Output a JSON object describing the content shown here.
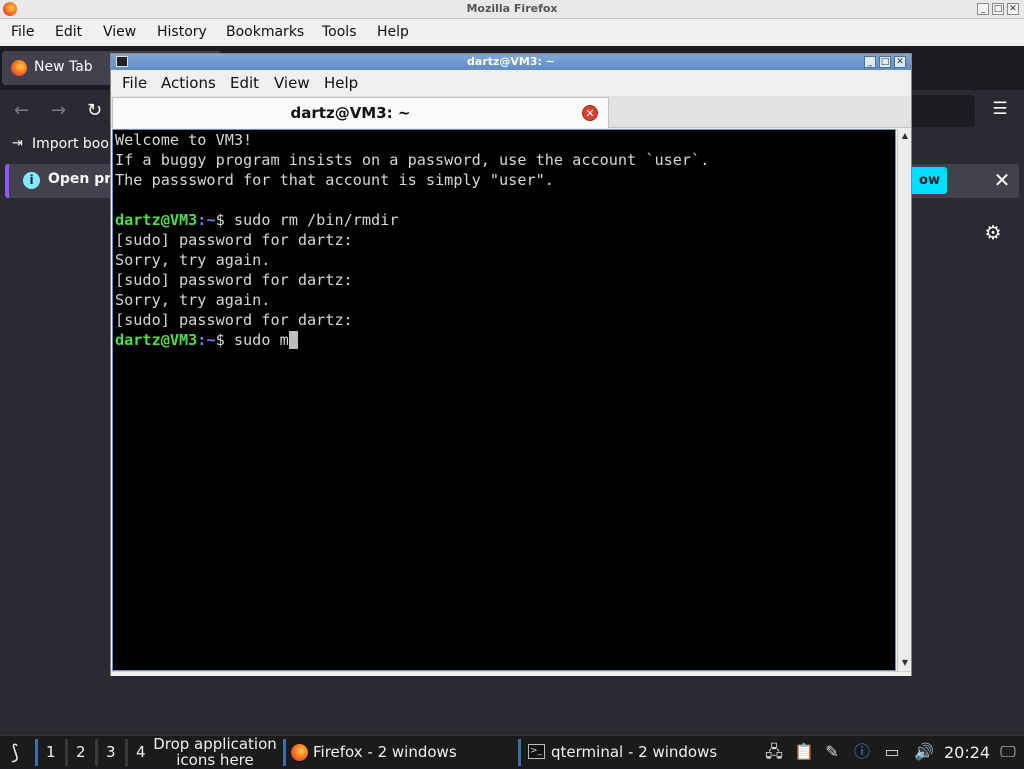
{
  "firefox": {
    "window_title": "Mozilla Firefox",
    "menu": [
      "File",
      "Edit",
      "View",
      "History",
      "Bookmarks",
      "Tools",
      "Help"
    ],
    "tab_title": "New Tab",
    "bookmarks_label": "Import book",
    "infobar_text": "Open pre",
    "infobar_button": "ow",
    "icons": {
      "back": "←",
      "forward": "→",
      "reload": "↻",
      "menu": "☰",
      "import": "⇥",
      "info": "i",
      "close": "✕",
      "settings": "⚙"
    }
  },
  "terminal": {
    "window_title": "dartz@VM3: ~",
    "menu": [
      "File",
      "Actions",
      "Edit",
      "View",
      "Help"
    ],
    "tab_title": "dartz@VM3: ~",
    "prompt_user": "dartz@VM3",
    "prompt_path": ":~",
    "prompt_symbol": "$ ",
    "lines": [
      "Welcome to VM3!",
      "If a buggy program insists on a password, use the account `user`.",
      "The passsword for that account is simply \"user\".",
      "",
      "sudo rm /bin/rmdir",
      "[sudo] password for dartz:",
      "Sorry, try again.",
      "[sudo] password for dartz:",
      "Sorry, try again.",
      "[sudo] password for dartz:",
      "sudo m"
    ],
    "colors": {
      "user": "#4fdc4f",
      "path": "#5c8cf0",
      "background": "#000000"
    }
  },
  "taskbar": {
    "workspaces": [
      "1",
      "2",
      "3",
      "4"
    ],
    "drop_hint": "Drop application icons here",
    "firefox_task": "Firefox - 2 windows",
    "terminal_task": "qterminal - 2 windows",
    "clock": "20:24",
    "tray_icons": [
      "network-icon",
      "clipboard-icon",
      "pen-icon",
      "notification-icon",
      "battery-icon",
      "volume-icon",
      "display-icon"
    ]
  }
}
